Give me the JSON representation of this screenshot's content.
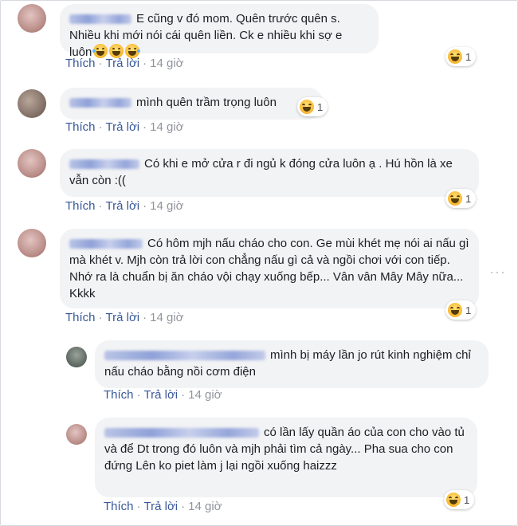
{
  "comments": [
    {
      "name": "Ng Nguyễn",
      "text": "E cũng v đó mom. Quên trước quên s. Nhiều khi mới nói cái quên liền. Ck e nhiều khi sợ e luôn",
      "emoji_count": 3,
      "like": "Thích",
      "reply": "Trả lời",
      "time": "14 giờ",
      "reactions": "1"
    },
    {
      "name": "Xuân Lâm",
      "text": "mình quên trầm trọng luôn",
      "like": "Thích",
      "reply": "Trả lời",
      "time": "14 giờ",
      "reactions": "1"
    },
    {
      "name": "Huỳnh Như",
      "text": "Có khi e mở cửa r đi ngủ k đóng cửa luôn ạ . Hú hồn là xe vẫn còn :((",
      "like": "Thích",
      "reply": "Trả lời",
      "time": "14 giờ",
      "reactions": "1"
    },
    {
      "name": "Diệp Nguyễn",
      "text": "Có hôm mjh nấu cháo cho con. Ge mùi khét mẹ nói ai nấu gì mà khét v. Mjh còn trả lời con chẳng nấu gì cả và ngồi chơi với con tiếp. Nhớ ra là chuẩn bị ăn cháo vội chạy xuống bếp... Vân vân Mây Mây nữa... Kkkk",
      "like": "Thích",
      "reply": "Trả lời",
      "time": "14 giờ",
      "reactions": "1"
    }
  ],
  "replies": [
    {
      "name": "Thùy Trang Lưu Nguyễn",
      "text": "mình bị máy lần jo rút kinh nghiệm chỉ nấu cháo bằng nồi cơm điện",
      "like": "Thích",
      "reply": "Trả lời",
      "time": "14 giờ"
    },
    {
      "name": "Đỗ Nguyễn Thu Trang",
      "text": "có lần lấy quần áo của con cho vào tủ và để Dt trong đó luôn và mjh phải tìm cả ngày... Pha sua cho con đứng Lên ko piet làm j lại ngồi xuống haizzz",
      "like": "Thích",
      "reply": "Trả lời",
      "time": "14 giờ",
      "reactions": "1"
    }
  ],
  "more_icon": "more-options-icon",
  "reaction_icon": "haha-reaction-icon"
}
